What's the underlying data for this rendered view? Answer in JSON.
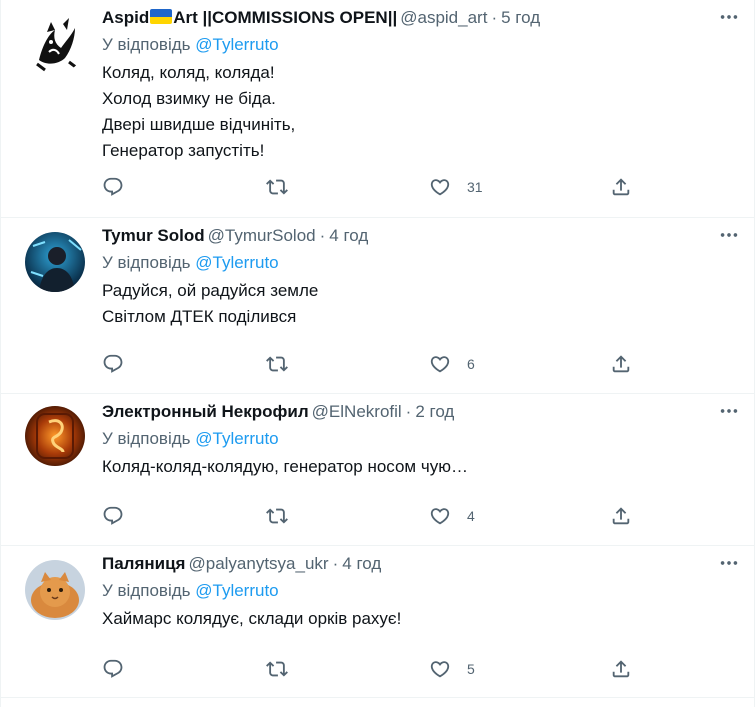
{
  "tweets": [
    {
      "name_a": "Aspid",
      "name_b": "Art ||COMMISSIONS OPEN||",
      "handle": "@aspid_art",
      "sep": "·",
      "time": "5 год",
      "reply_prefix": "У відповідь",
      "reply_to": "@Tylerruto",
      "lines": [
        "Коляд, коляд, коляда!",
        "Холод взимку не біда.",
        "Двері швидше відчиніть,",
        "Генератор запустіть!"
      ],
      "likes": "31"
    },
    {
      "name": "Tymur Solod",
      "handle": "@TymurSolod",
      "sep": "·",
      "time": "4 год",
      "reply_prefix": "У відповідь",
      "reply_to": "@Tylerruto",
      "lines": [
        "Радуйся, ой радуйся земле",
        "Світлом ДТЕК поділився"
      ],
      "likes": "6"
    },
    {
      "name": "Электронный Некрофил",
      "handle": "@ElNekrofil",
      "sep": "·",
      "time": "2 год",
      "reply_prefix": "У відповідь",
      "reply_to": "@Tylerruto",
      "lines": [
        "Коляд-коляд-колядую, генератор носом чую…"
      ],
      "likes": "4"
    },
    {
      "name": "Паляниця",
      "handle": "@palyanytsya_ukr",
      "sep": "·",
      "time": "4 год",
      "reply_prefix": "У відповідь",
      "reply_to": "@Tylerruto",
      "lines": [
        "Хаймарс колядує, склади орків рахує!"
      ],
      "likes": "5"
    }
  ],
  "colors": {
    "text": "#0f1419",
    "secondary": "#536471",
    "link": "#1d9bf0",
    "divider": "#eff3f4",
    "flag_blue": "#1f66c9",
    "flag_yellow": "#ffd500"
  },
  "icons": {
    "reply": "reply-icon",
    "retweet": "retweet-icon",
    "like": "like-icon",
    "share": "share-icon",
    "more": "more-icon"
  }
}
